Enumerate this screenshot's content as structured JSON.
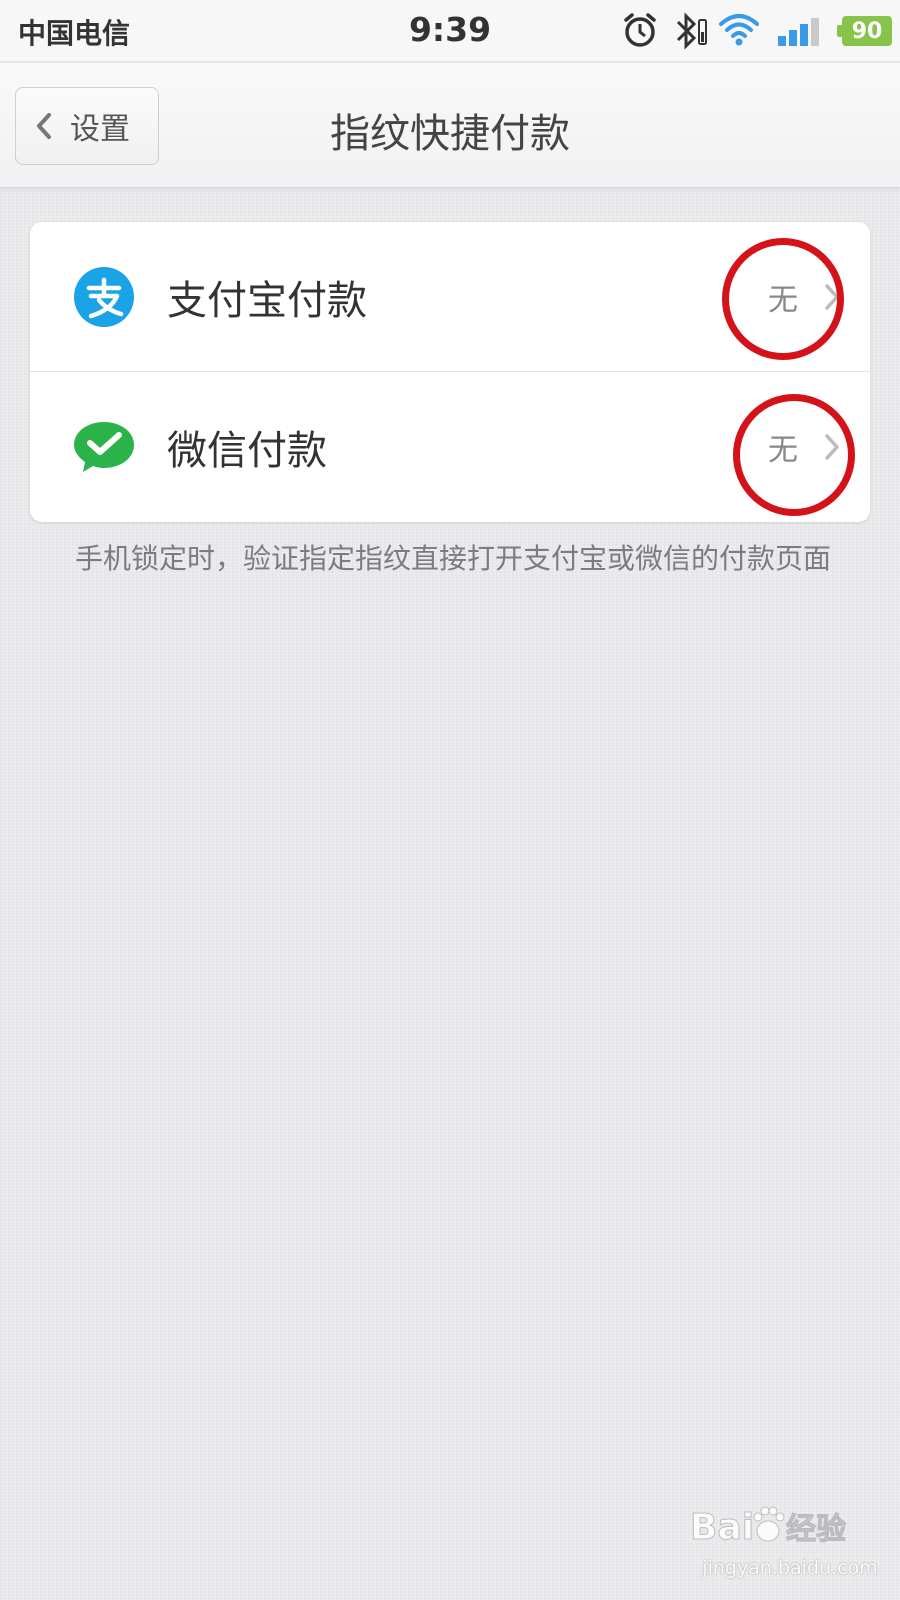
{
  "status_bar": {
    "carrier": "中国电信",
    "time": "9:39",
    "battery_level": "90",
    "icons": [
      "alarm-icon",
      "bluetooth-icon",
      "wifi-icon",
      "signal-icon",
      "battery-icon"
    ]
  },
  "nav": {
    "back_label": "设置",
    "title": "指纹快捷付款"
  },
  "payment_options": [
    {
      "label": "支付宝付款",
      "value": "无",
      "icon": "alipay-icon",
      "color": "#1aa3e6"
    },
    {
      "label": "微信付款",
      "value": "无",
      "icon": "wechat-pay-icon",
      "color": "#2bb34a"
    }
  ],
  "description": "手机锁定时，验证指定指纹直接打开支付宝或微信的付款页面",
  "watermark": {
    "brand": "Baidu经验",
    "url": "jingyan.baidu.com"
  },
  "colors": {
    "annotation": "#d4121a",
    "battery": "#88c34a",
    "wifi": "#3a9ae8"
  }
}
